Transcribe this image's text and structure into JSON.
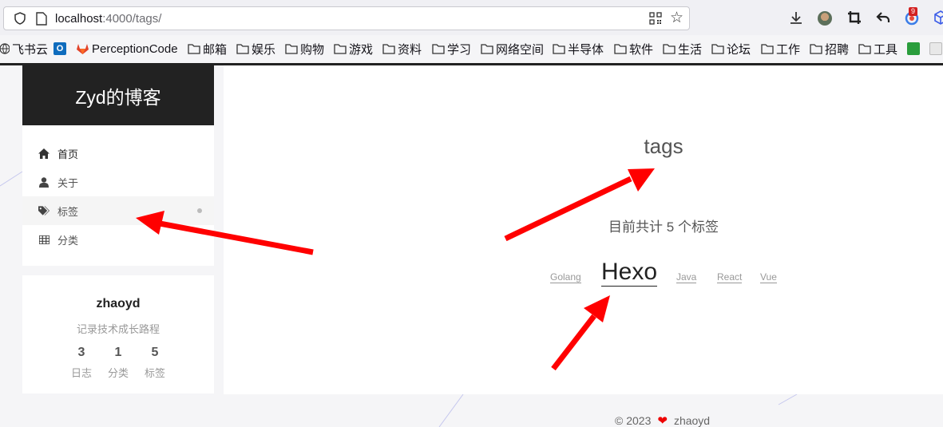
{
  "browser": {
    "url_host": "localhost",
    "url_rest": ":4000/tags/",
    "notification_badge": "9"
  },
  "bookmarks": [
    {
      "label": "飞书云",
      "icon": "globe-icon"
    },
    {
      "label": "",
      "icon": "outlook-icon"
    },
    {
      "label": "PerceptionCode",
      "icon": "gitlab-icon"
    },
    {
      "label": "邮箱",
      "icon": "folder-icon"
    },
    {
      "label": "娱乐",
      "icon": "folder-icon"
    },
    {
      "label": "购物",
      "icon": "folder-icon"
    },
    {
      "label": "游戏",
      "icon": "folder-icon"
    },
    {
      "label": "资料",
      "icon": "folder-icon"
    },
    {
      "label": "学习",
      "icon": "folder-icon"
    },
    {
      "label": "网络空间",
      "icon": "folder-icon"
    },
    {
      "label": "半导体",
      "icon": "folder-icon"
    },
    {
      "label": "软件",
      "icon": "folder-icon"
    },
    {
      "label": "生活",
      "icon": "folder-icon"
    },
    {
      "label": "论坛",
      "icon": "folder-icon"
    },
    {
      "label": "工作",
      "icon": "folder-icon"
    },
    {
      "label": "招聘",
      "icon": "folder-icon"
    },
    {
      "label": "工具",
      "icon": "folder-icon"
    }
  ],
  "site": {
    "brand": "Zyd的博客",
    "menu": [
      {
        "label": "首页",
        "icon": "home-icon"
      },
      {
        "label": "关于",
        "icon": "user-icon"
      },
      {
        "label": "标签",
        "icon": "tags-icon"
      },
      {
        "label": "分类",
        "icon": "grid-icon"
      }
    ],
    "author": "zhaoyd",
    "description": "记录技术成长路程",
    "stats": [
      {
        "count": "3",
        "label": "日志"
      },
      {
        "count": "1",
        "label": "分类"
      },
      {
        "count": "5",
        "label": "标签"
      }
    ]
  },
  "main": {
    "title": "tags",
    "count_text": "目前共计 5 个标签",
    "tags": [
      "Golang",
      "Hexo",
      "Java",
      "React",
      "Vue"
    ]
  },
  "footer": {
    "copyright": "© 2023",
    "author": "zhaoyd"
  },
  "colors": {
    "annotation_arrow": "#ff0000",
    "brand_bg": "#222222",
    "heart": "#ee0000"
  }
}
